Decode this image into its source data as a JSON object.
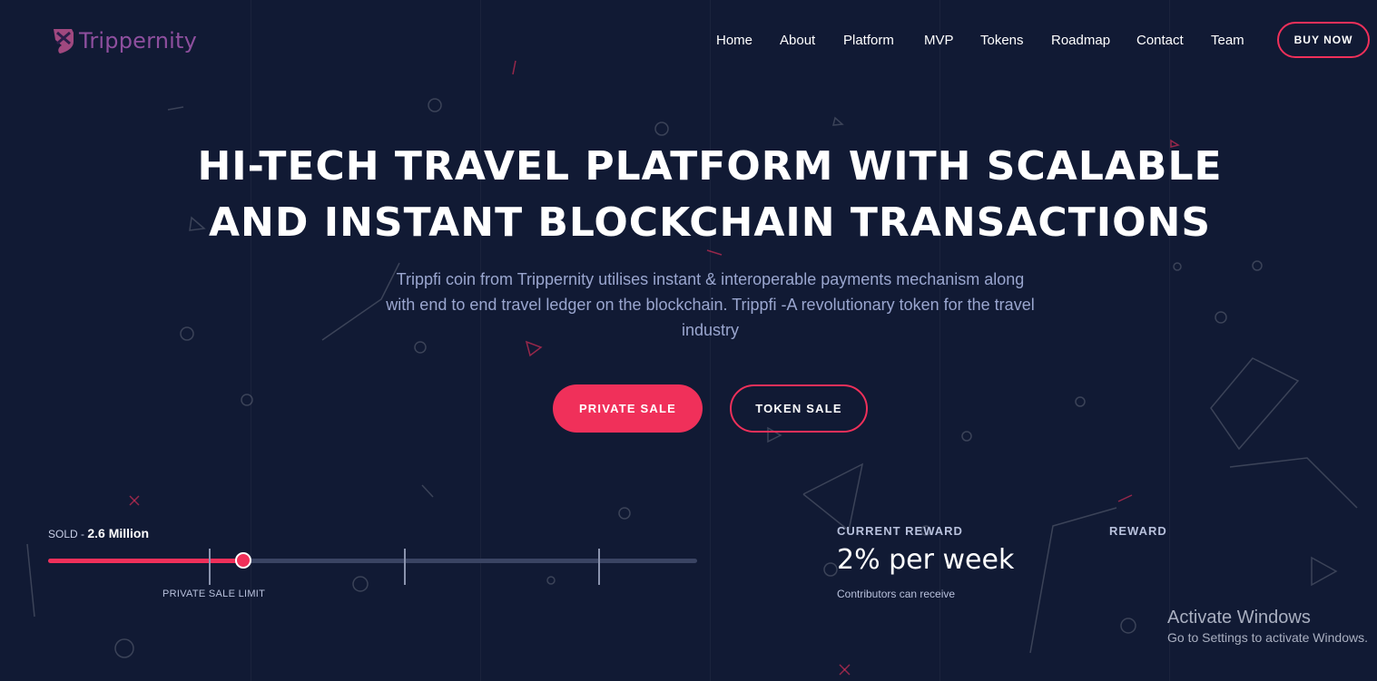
{
  "brand": {
    "name": "Trippernity",
    "accent": "#f0305a",
    "logo_color": "#8e4f9e",
    "background": "#111a34"
  },
  "nav": {
    "items": [
      "Home",
      "About",
      "Platform",
      "MVP",
      "Tokens",
      "Roadmap",
      "Contact",
      "Team"
    ],
    "buy_label": "BUY NOW"
  },
  "hero": {
    "title_line1": "HI-TECH TRAVEL PLATFORM WITH SCALABLE",
    "title_line2": "AND INSTANT BLOCKCHAIN TRANSACTIONS",
    "subtitle": "Trippfi coin from Trippernity utilises instant & interoperable payments mechanism along with end to end travel ledger on the blockchain. Trippfi -A revolutionary token for the travel industry",
    "primary_button": "PRIVATE SALE",
    "secondary_button": "TOKEN SALE"
  },
  "progress": {
    "sold_prefix": "SOLD - ",
    "sold_value": "2.6 Million",
    "fraction": 0.3,
    "limit_label": "PRIVATE SALE LIMIT"
  },
  "rewards": {
    "current_label": "CURRENT REWARD",
    "current_value": "2% per week",
    "current_note": "Contributors can receive",
    "reward_label": "REWARD"
  },
  "watermark": {
    "title": "Activate Windows",
    "subtitle": "Go to Settings to activate Windows."
  }
}
